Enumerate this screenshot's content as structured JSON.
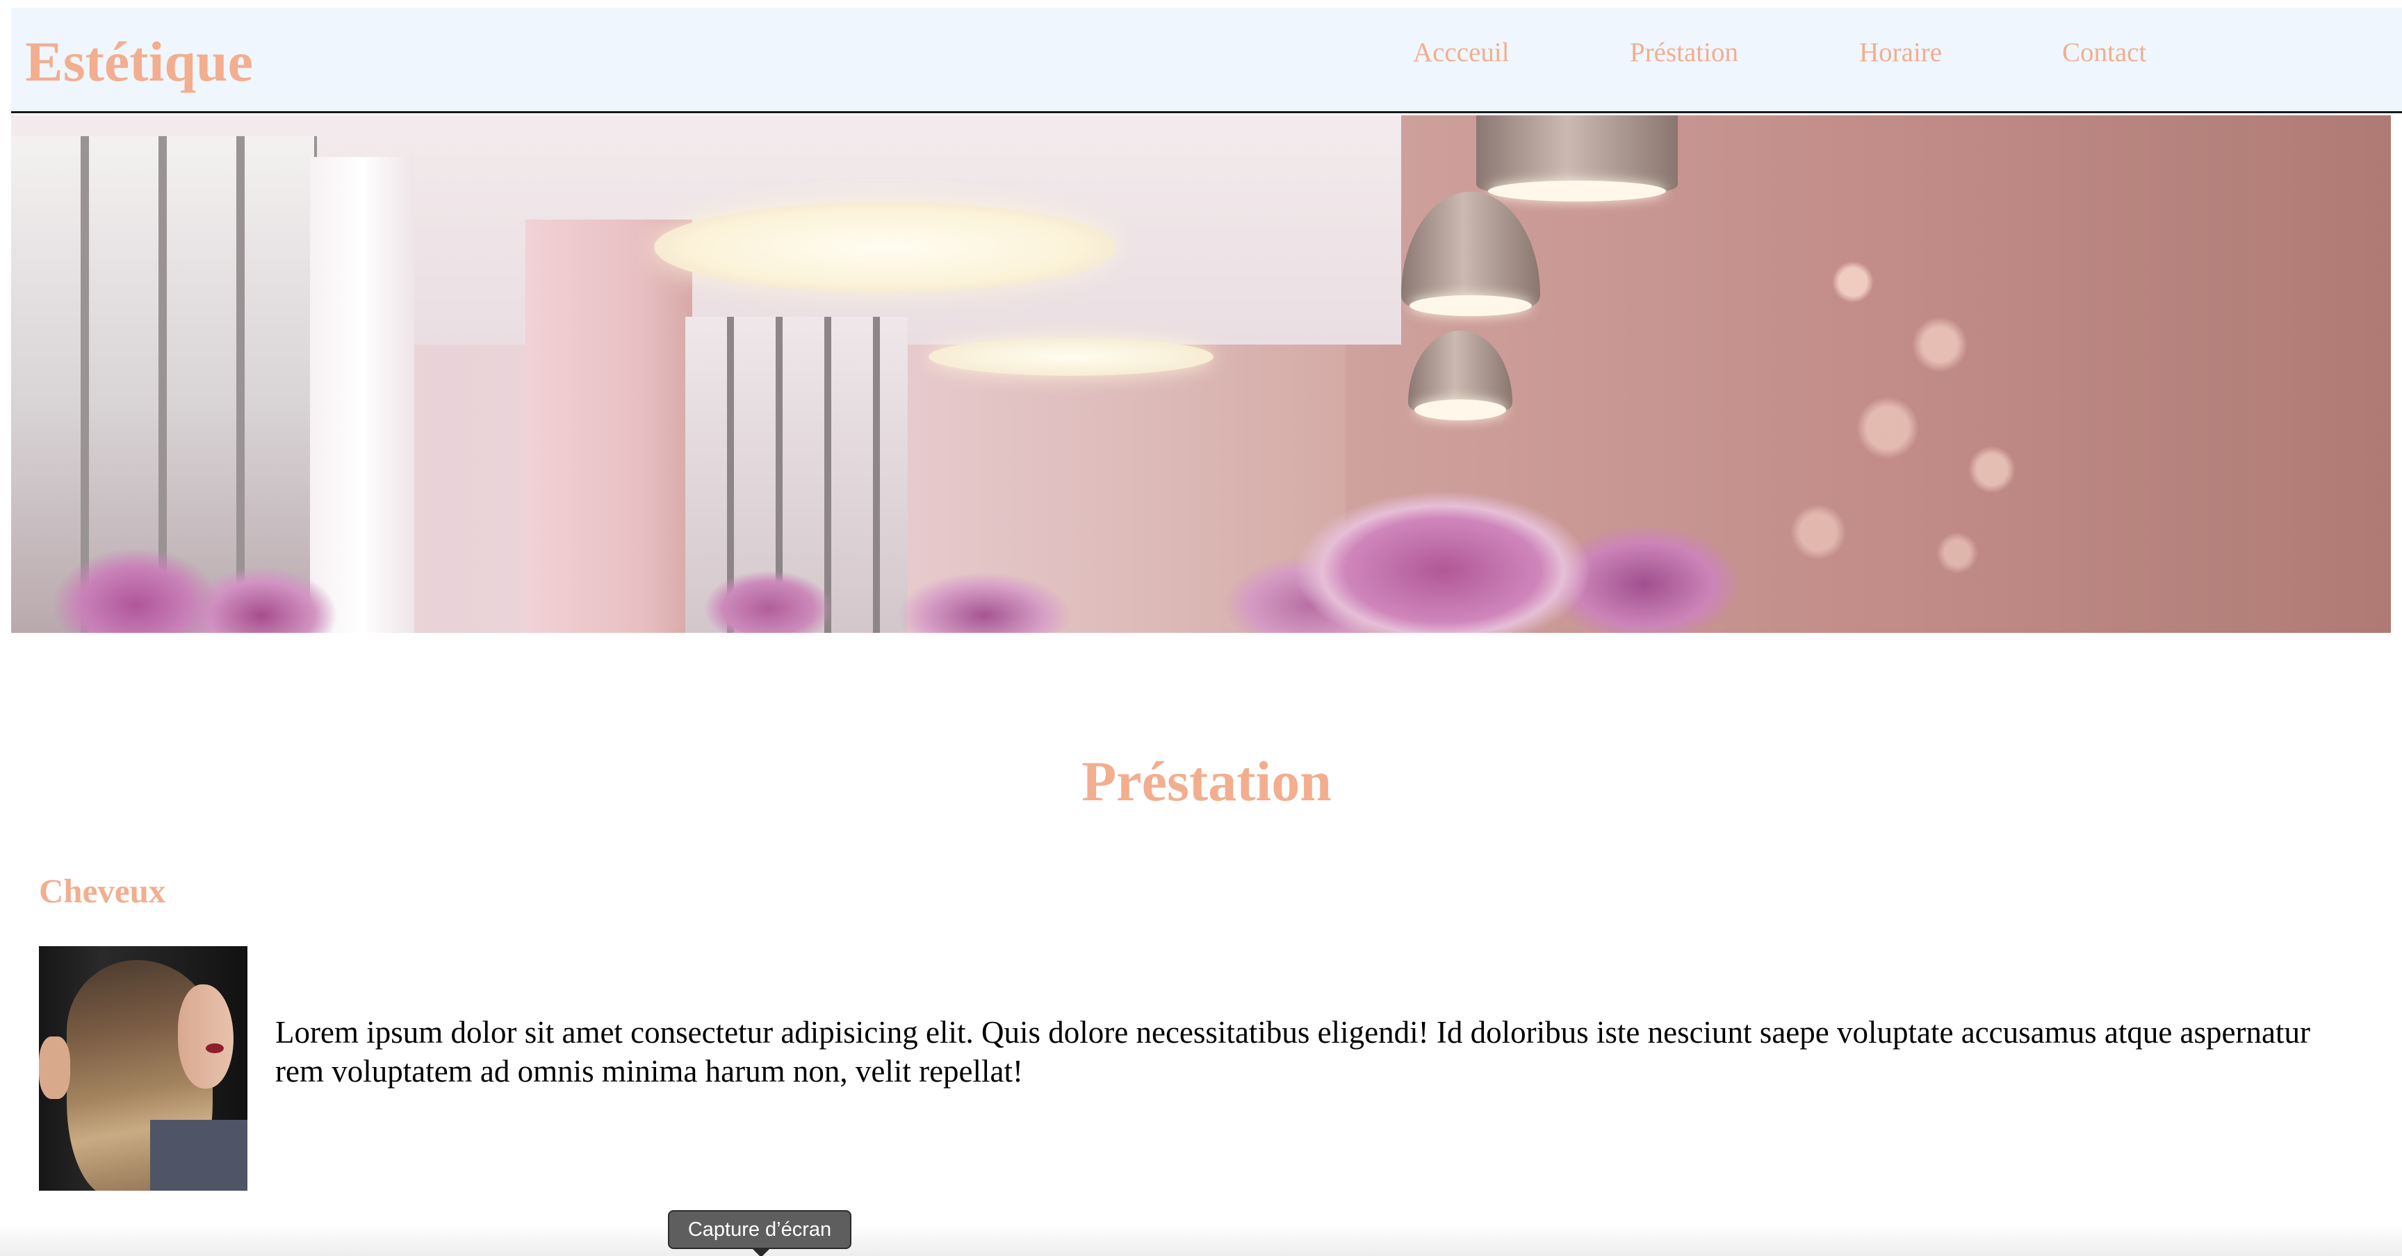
{
  "header": {
    "logo": "Estétique",
    "nav": [
      "Accceuil",
      "Préstation",
      "Horaire",
      "Contact"
    ]
  },
  "hero": {
    "image": "salon-interior-photo"
  },
  "main": {
    "section_title": "Préstation",
    "category": "Cheveux",
    "description": "Lorem ipsum dolor sit amet consectetur adipisicing elit. Quis dolore necessitatibus eligendi! Id doloribus iste nesciunt saepe voluptate accusamus atque aspernatur rem voluptatem ad omnis minima harum non, velit repellat!",
    "image": "hair-style-photo"
  },
  "overlay": {
    "tooltip": "Capture d’écran"
  },
  "colors": {
    "accent": "#f2ae8f",
    "header_bg": "#eff6fd",
    "text": "#000000"
  }
}
